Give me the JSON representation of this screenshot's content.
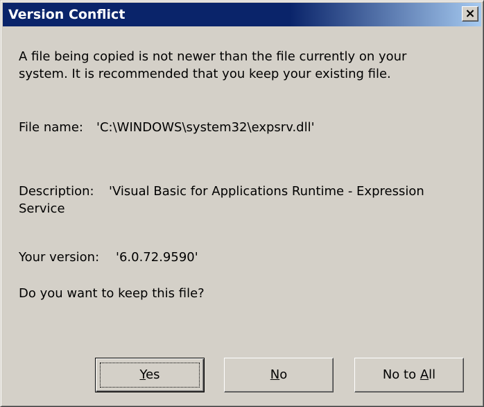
{
  "window": {
    "title": "Version Conflict",
    "close_glyph": "×",
    "close_icon": "close-icon"
  },
  "message": {
    "line1": "A file being copied is not newer than the file currently on your",
    "line2": "system. It is recommended that you keep your existing file."
  },
  "file_name": {
    "label": "File name:",
    "value": "'C:\\WINDOWS\\system32\\expsrv.dll'"
  },
  "description": {
    "label": "Description:",
    "value_line1": "'Visual Basic for Applications Runtime - Expression",
    "value_line2": "Service"
  },
  "version": {
    "label": "Your version:",
    "value": "'6.0.72.9590'"
  },
  "question": "Do you want to keep this file?",
  "buttons": {
    "yes": {
      "mnemonic": "Y",
      "rest": "es"
    },
    "no": {
      "mnemonic": "N",
      "rest": "o"
    },
    "no_to_all": {
      "prefix": "No to ",
      "mnemonic": "A",
      "rest": "ll"
    }
  },
  "colors": {
    "titlebar_start": "#0a246a",
    "titlebar_end": "#a6caf0",
    "face": "#d4d0c8"
  }
}
